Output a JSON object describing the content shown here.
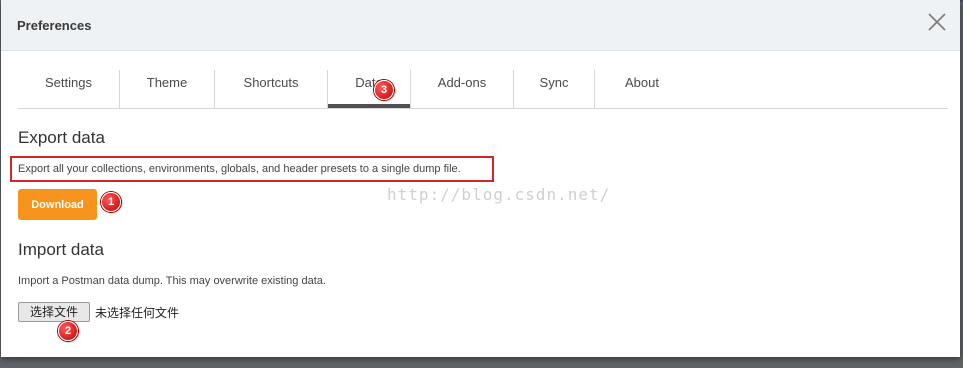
{
  "dialog": {
    "title": "Preferences"
  },
  "tabs": [
    {
      "label": "Settings"
    },
    {
      "label": "Theme"
    },
    {
      "label": "Shortcuts"
    },
    {
      "label": "Data",
      "active": true
    },
    {
      "label": "Add-ons"
    },
    {
      "label": "Sync"
    },
    {
      "label": "About"
    }
  ],
  "export_section": {
    "title": "Export data",
    "description": "Export all your collections, environments, globals, and header presets to a single dump file.",
    "button_label": "Download"
  },
  "import_section": {
    "title": "Import data",
    "description": "Import a Postman data dump. This may overwrite existing data.",
    "file_button_label": "选择文件",
    "file_status": "未选择任何文件"
  },
  "annotations": {
    "marker_1": "1",
    "marker_2": "2",
    "marker_3": "3",
    "highlight_color": "#d62728"
  },
  "watermark": "http://blog.csdn.net/",
  "colors": {
    "accent": "#f7941d",
    "header_bg": "#eef2f5",
    "active_tab_bar": "#505050"
  }
}
